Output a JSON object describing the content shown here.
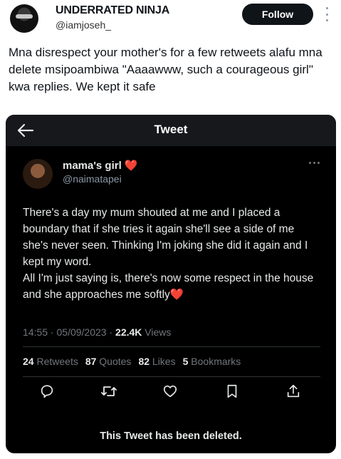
{
  "post": {
    "author_name": "UNDERRATED NINJA",
    "author_handle": "@iamjoseh_",
    "follow_label": "Follow",
    "text": "Mna disrespect your mother's for a few retweets alafu mna delete msipoambiwa \"Aaaawww, such a courageous girl\" kwa replies. We kept it safe"
  },
  "quoted": {
    "header_title": "Tweet",
    "author_name": "mama's girl",
    "author_emoji": "❤️",
    "author_handle": "@naimatapei",
    "text_lines": [
      "There's a day my mum shouted at me and I placed a boundary that if she tries it again she'll see a side of me she's never seen. Thinking I'm joking she did it again and I kept my word.",
      "All I'm just saying is, there's now some respect in the house and she approaches me softly❤️"
    ],
    "time": "14:55",
    "date": "05/09/2023",
    "views_count": "22.4K",
    "views_label": "Views",
    "stats": {
      "retweets_count": "24",
      "retweets_label": "Retweets",
      "quotes_count": "87",
      "quotes_label": "Quotes",
      "likes_count": "82",
      "likes_label": "Likes",
      "bookmarks_count": "5",
      "bookmarks_label": "Bookmarks"
    },
    "deleted_notice": "This Tweet has been deleted."
  },
  "icons": [
    "back-arrow-icon",
    "more-icon",
    "reply-icon",
    "retweet-icon",
    "like-icon",
    "bookmark-icon",
    "share-icon",
    "heart-emoji-icon"
  ]
}
